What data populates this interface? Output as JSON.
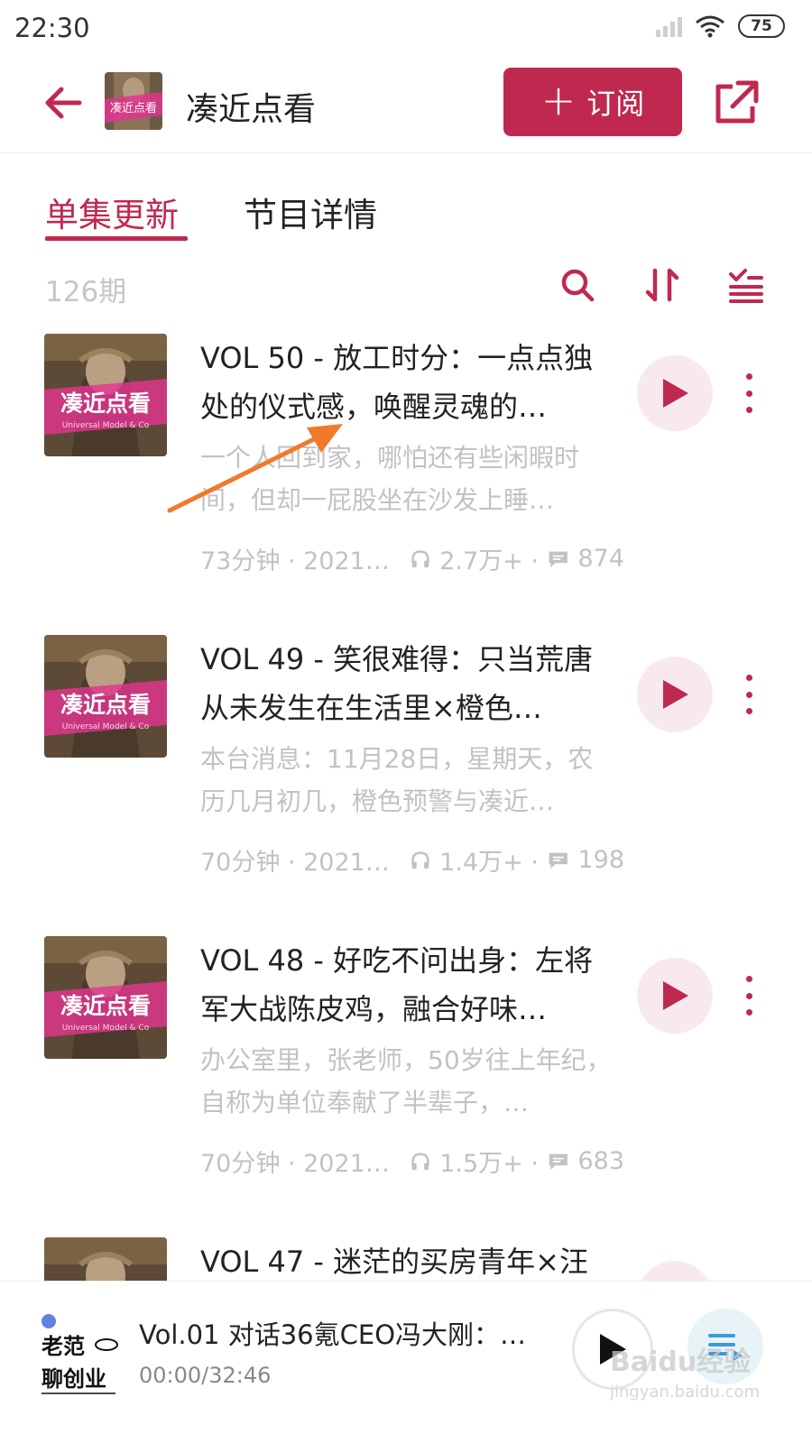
{
  "status_bar": {
    "time": "22:30",
    "battery": "75"
  },
  "header": {
    "podcast_title": "凑近点看",
    "subscribe_label": "订阅",
    "cover_text": "凑近点看"
  },
  "tabs": [
    {
      "label": "单集更新",
      "active": true
    },
    {
      "label": "节目详情",
      "active": false
    }
  ],
  "toolbar": {
    "episode_count": "126期",
    "icons": [
      "search-icon",
      "sort-icon",
      "filter-list-icon"
    ]
  },
  "colors": {
    "accent": "#c0294f",
    "muted_text": "#c2c2c2",
    "play_bg": "#f8e9ee",
    "annotation_arrow": "#f07a2a"
  },
  "episodes": [
    {
      "title": "VOL 50 - 放工时分：一点点独处的仪式感，唤醒灵魂的…",
      "description": "一个人回到家，哪怕还有些闲暇时间，但却一屁股坐在沙发上睡…",
      "duration_date": "73分钟 · 2021…",
      "plays": "2.7万+ ·",
      "comments": "874",
      "cover_text": "凑近点看",
      "cover_subtext": "Universal Model & Co"
    },
    {
      "title": "VOL 49 - 笑很难得：只当荒唐从未发生在生活里×橙色…",
      "description": "本台消息：11月28日，星期天，农历几月初几，橙色预警与凑近…",
      "duration_date": "70分钟 · 2021…",
      "plays": "1.4万+ ·",
      "comments": "198",
      "cover_text": "凑近点看",
      "cover_subtext": "Universal Model & Co"
    },
    {
      "title": "VOL 48 - 好吃不问出身：左将军大战陈皮鸡，融合好味…",
      "description": "办公室里，张老师，50岁往上年纪，自称为单位奉献了半辈子，…",
      "duration_date": "70分钟 · 2021…",
      "plays": "1.5万+ ·",
      "comments": "683",
      "cover_text": "凑近点看",
      "cover_subtext": "Universal Model & Co"
    },
    {
      "title": "VOL 47 - 迷茫的买房青年×汪",
      "description": "",
      "duration_date": "",
      "plays": "",
      "comments": "",
      "cover_text": "",
      "cover_subtext": ""
    }
  ],
  "player": {
    "cover_line1": "老范",
    "cover_line2": "聊创业",
    "title": "Vol.01 对话36氪CEO冯大刚：…",
    "time": "00:00/32:46"
  },
  "watermark": {
    "brand": "Baidu经验",
    "url": "jingyan.baidu.com"
  }
}
